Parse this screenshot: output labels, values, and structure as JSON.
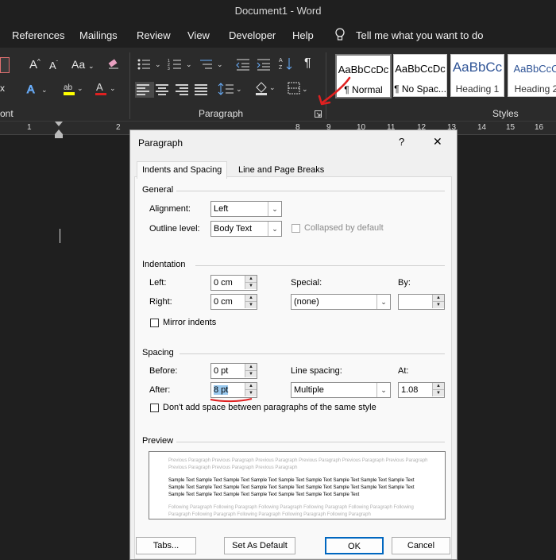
{
  "window": {
    "title": "Document1  -  Word"
  },
  "menu": [
    "References",
    "Mailings",
    "Review",
    "View",
    "Developer",
    "Help"
  ],
  "tell_me": "Tell me what you want to do",
  "ribbon": {
    "font_group_label": "ont",
    "paragraph_group_label": "Paragraph",
    "styles_group_label": "Styles",
    "font_aa": "Aa",
    "pilcrow": "¶",
    "styles": [
      {
        "sample": "AaBbCcDc",
        "name": "¶ Normal"
      },
      {
        "sample": "AaBbCcDc",
        "name": "¶ No Spac..."
      },
      {
        "sample": "AaBbCc",
        "name": "Heading 1"
      },
      {
        "sample": "AaBbCcC",
        "name": "Heading 2"
      }
    ]
  },
  "ruler": [
    "1",
    "2",
    "8",
    "9",
    "10",
    "11",
    "12",
    "13",
    "14",
    "15",
    "16"
  ],
  "dialog": {
    "title": "Paragraph",
    "help": "?",
    "close": "✕",
    "tabs": [
      "Indents and Spacing",
      "Line and Page Breaks"
    ],
    "general": {
      "heading": "General",
      "alignment_label": "Alignment:",
      "alignment_value": "Left",
      "outline_label": "Outline level:",
      "outline_value": "Body Text",
      "collapsed_label": "Collapsed by default"
    },
    "indentation": {
      "heading": "Indentation",
      "left_label": "Left:",
      "left_value": "0 cm",
      "right_label": "Right:",
      "right_value": "0 cm",
      "special_label": "Special:",
      "special_value": "(none)",
      "by_label": "By:",
      "by_value": "",
      "mirror_label": "Mirror indents"
    },
    "spacing": {
      "heading": "Spacing",
      "before_label": "Before:",
      "before_value": "0 pt",
      "after_label": "After:",
      "after_value": "8 pt",
      "line_label": "Line spacing:",
      "line_value": "Multiple",
      "at_label": "At:",
      "at_value": "1.08",
      "dont_add_label": "Don't add space between paragraphs of the same style"
    },
    "preview": {
      "heading": "Preview",
      "previous": "Previous Paragraph Previous Paragraph Previous Paragraph Previous Paragraph Previous Paragraph Previous Paragraph Previous Paragraph Previous Paragraph Previous Paragraph",
      "sample": "Sample Text Sample Text Sample Text Sample Text Sample Text Sample Text Sample Text Sample Text Sample Text Sample Text Sample Text Sample Text Sample Text Sample Text Sample Text Sample Text Sample Text Sample Text Sample Text Sample Text Sample Text Sample Text Sample Text Sample Text Sample Text",
      "following": "Following Paragraph Following Paragraph Following Paragraph Following Paragraph Following Paragraph Following Paragraph Following Paragraph Following Paragraph Following Paragraph Following Paragraph"
    },
    "buttons": {
      "tabs": "Tabs...",
      "set_default": "Set As Default",
      "ok": "OK",
      "cancel": "Cancel"
    }
  },
  "colors": {
    "annotation_red": "#e02020",
    "highlight_yellow": "#ffff00",
    "selection_blue": "#99c9ef",
    "ok_border": "#0067c0"
  }
}
